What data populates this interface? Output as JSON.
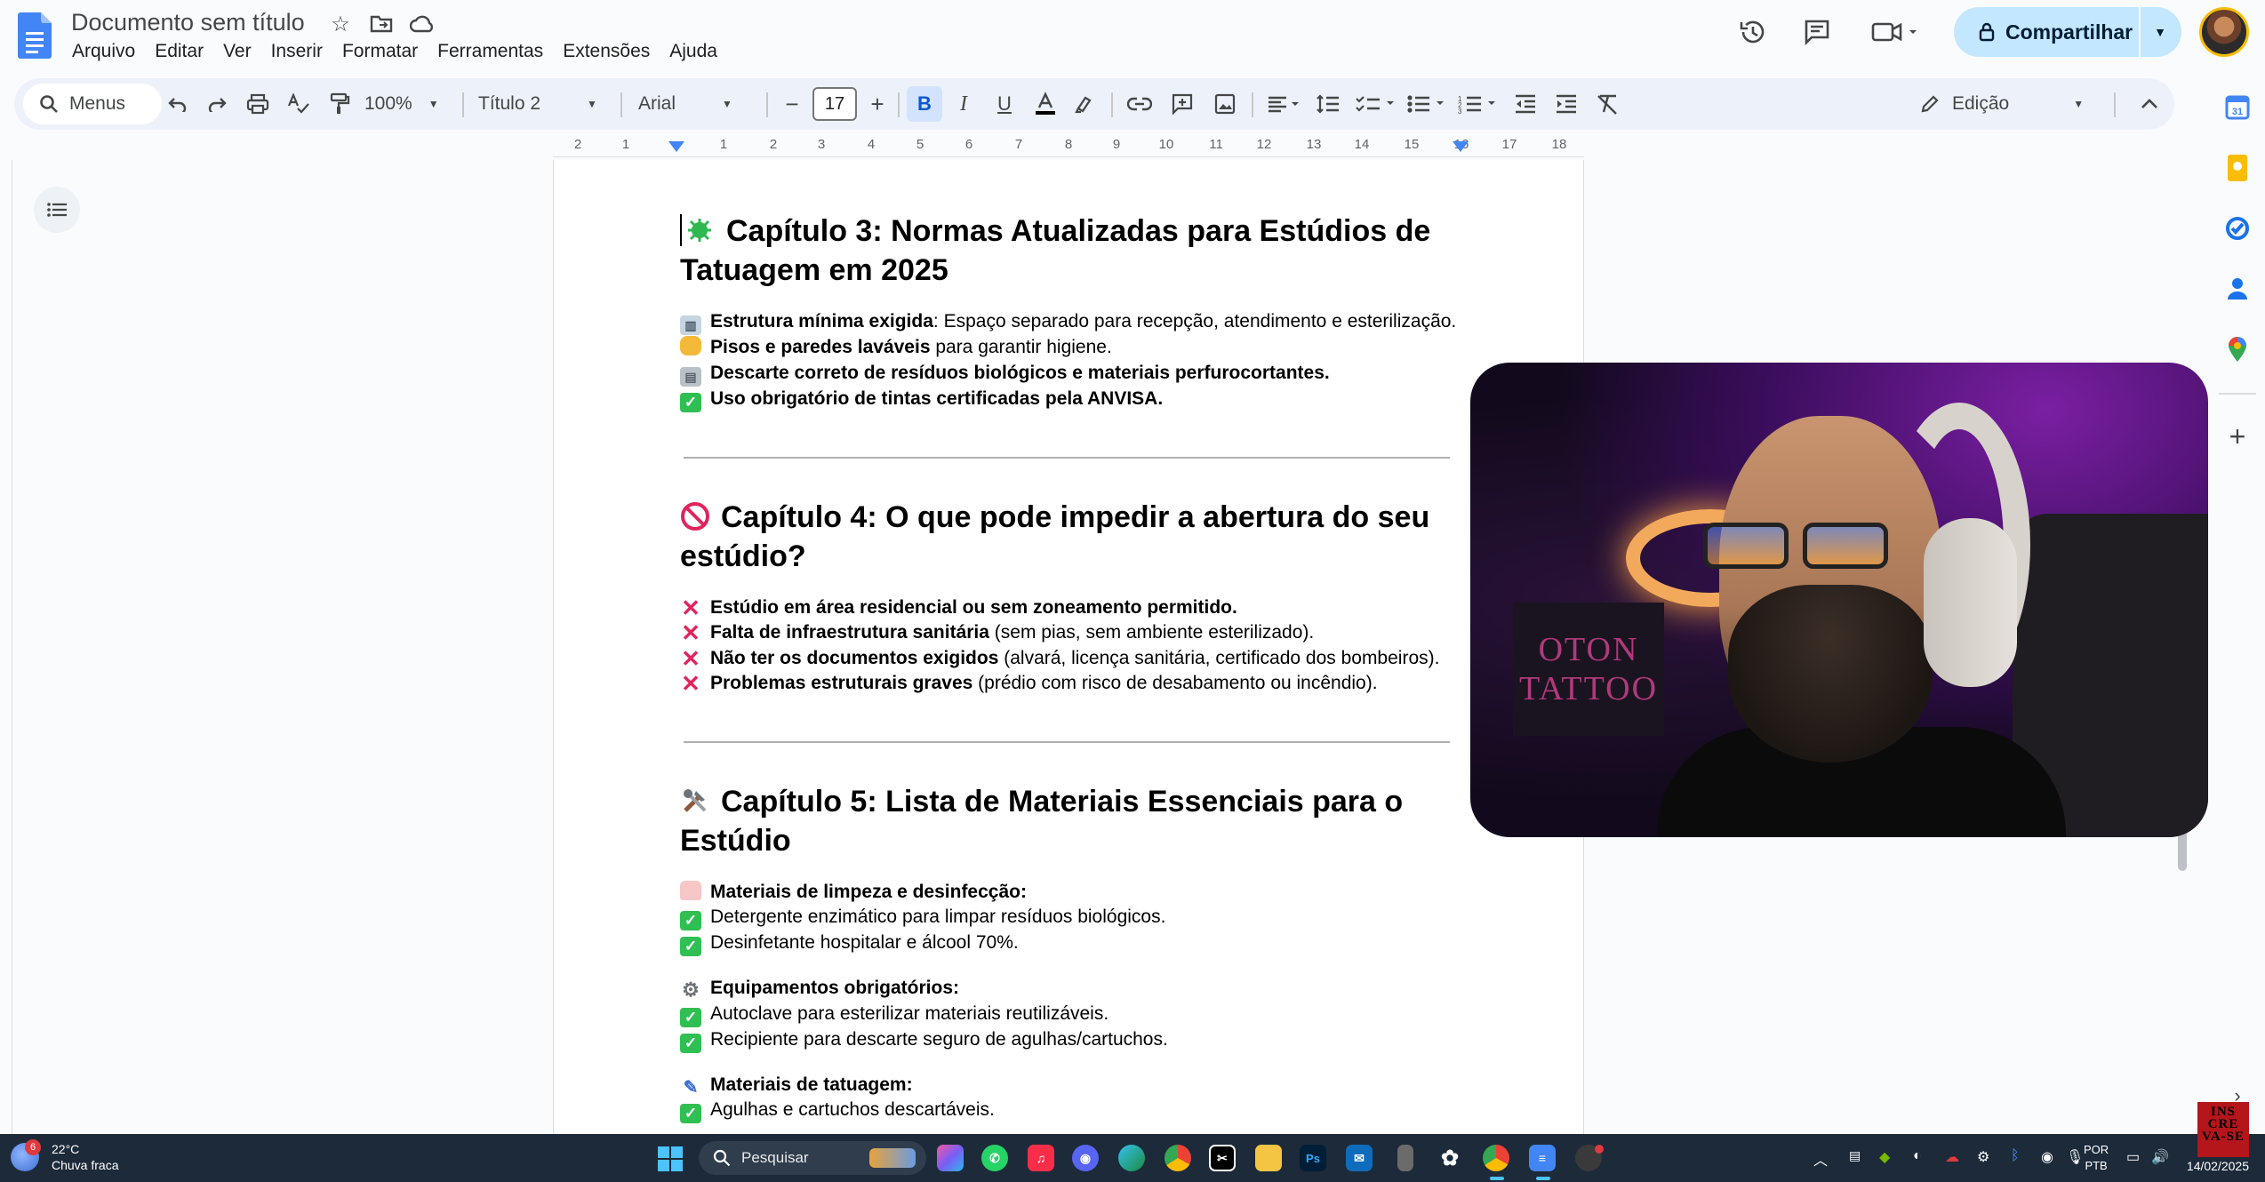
{
  "app": {
    "doc_title": "Documento sem título",
    "menu": [
      "Arquivo",
      "Editar",
      "Ver",
      "Inserir",
      "Formatar",
      "Ferramentas",
      "Extensões",
      "Ajuda"
    ],
    "share_label": "Compartilhar",
    "accent_color": "#c2e7ff"
  },
  "toolbar": {
    "search_label": "Menus",
    "zoom": "100%",
    "style": "Título 2",
    "font": "Arial",
    "font_size": "17",
    "minus": "−",
    "plus": "+",
    "bold": "B",
    "italic": "I",
    "underline": "U",
    "mode": "Edição"
  },
  "ruler": {
    "labels": [
      "2",
      "1",
      "1",
      "1",
      "2",
      "3",
      "4",
      "5",
      "6",
      "7",
      "8",
      "9",
      "10",
      "11",
      "12",
      "13",
      "14",
      "15",
      "16",
      "17",
      "18"
    ]
  },
  "document": {
    "ch3": {
      "title": "Capítulo 3: Normas Atualizadas para Estúdios de Tatuagem em 2025",
      "items": [
        {
          "bold": "Estrutura mínima exigida",
          "rest": ": Espaço separado para recepção, atendimento e esterilização."
        },
        {
          "bold": "Pisos e paredes laváveis",
          "rest": " para garantir higiene."
        },
        {
          "bold": "Descarte correto de resíduos biológicos e materiais perfurocortantes.",
          "rest": ""
        },
        {
          "bold": "Uso obrigatório de tintas certificadas pela ANVISA.",
          "rest": ""
        }
      ]
    },
    "ch4": {
      "title": "Capítulo 4: O que pode impedir a abertura do seu estúdio?",
      "items": [
        {
          "bold": "Estúdio em área residencial ou sem zoneamento permitido.",
          "rest": ""
        },
        {
          "bold": "Falta de infraestrutura sanitária",
          "rest": " (sem pias, sem ambiente esterilizado)."
        },
        {
          "bold": "Não ter os documentos exigidos",
          "rest": " (alvará, licença sanitária, certificado dos bombeiros)."
        },
        {
          "bold": "Problemas estruturais graves",
          "rest": " (prédio com risco de desabamento ou incêndio)."
        }
      ]
    },
    "ch5": {
      "title": "Capítulo 5: Lista de Materiais Essenciais para o Estúdio",
      "group1_title": "Materiais de limpeza e desinfecção:",
      "group1": [
        "Detergente enzimático para limpar resíduos biológicos.",
        "Desinfetante hospitalar e álcool 70%."
      ],
      "group2_title": "Equipamentos obrigatórios:",
      "group2": [
        "Autoclave para esterilizar materiais reutilizáveis.",
        "Recipiente para descarte seguro de agulhas/cartuchos."
      ],
      "group3_title": "Materiais de tatuagem:",
      "group3": [
        "Agulhas e cartuchos descartáveis."
      ]
    }
  },
  "webcam": {
    "sign_line1": "OTON",
    "sign_line2": "TATTOO"
  },
  "taskbar": {
    "temperature": "22°C",
    "weather": "Chuva fraca",
    "weather_badge": "6",
    "search_label": "Pesquisar",
    "lang": "POR",
    "layout": "PTB",
    "date": "14/02/2025",
    "subscribe_line1": "INS",
    "subscribe_line2": "CRE",
    "subscribe_line3": "VA-SE"
  }
}
